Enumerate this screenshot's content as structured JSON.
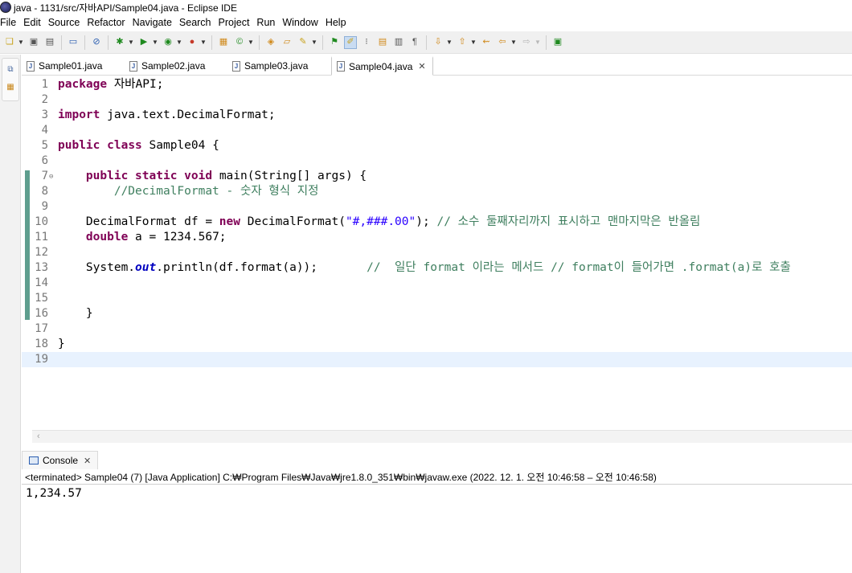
{
  "window": {
    "title": "java - 1131/src/자바API/Sample04.java - Eclipse IDE"
  },
  "menu": [
    "File",
    "Edit",
    "Source",
    "Refactor",
    "Navigate",
    "Search",
    "Project",
    "Run",
    "Window",
    "Help"
  ],
  "toolbar": {
    "icons": [
      "new-file-icon",
      "save-icon",
      "save-all-icon",
      "terminal-icon",
      "skip-breakpoints-icon",
      "debug-icon",
      "run-icon",
      "coverage-icon",
      "external-tools-icon",
      "new-java-project-icon",
      "new-class-icon",
      "open-type-icon",
      "open-folder-icon",
      "search-icon",
      "toggle-markers-icon",
      "toggle-mark-occurrences-icon",
      "block-selection-icon",
      "word-wrap-icon",
      "show-whitespace-icon",
      "next-annotation-icon",
      "previous-annotation-icon",
      "last-edit-location-icon",
      "back-icon",
      "forward-icon",
      "perspective-icon"
    ]
  },
  "editor": {
    "tabs": [
      {
        "label": "Sample01.java",
        "active": false
      },
      {
        "label": "Sample02.java",
        "active": false
      },
      {
        "label": "Sample03.java",
        "active": false
      },
      {
        "label": "Sample04.java",
        "active": true
      }
    ],
    "lines": [
      {
        "n": "1",
        "tokens": [
          [
            "kw",
            "package"
          ],
          [
            "",
            " 자바API;"
          ]
        ]
      },
      {
        "n": "2",
        "tokens": []
      },
      {
        "n": "3",
        "tokens": [
          [
            "kw",
            "import"
          ],
          [
            "",
            " java.text.DecimalFormat;"
          ]
        ]
      },
      {
        "n": "4",
        "tokens": []
      },
      {
        "n": "5",
        "tokens": [
          [
            "kw",
            "public"
          ],
          [
            "",
            " "
          ],
          [
            "kw",
            "class"
          ],
          [
            "",
            " Sample04 {"
          ]
        ]
      },
      {
        "n": "6",
        "tokens": []
      },
      {
        "n": "7",
        "fold": true,
        "tokens": [
          [
            "",
            "    "
          ],
          [
            "kw",
            "public"
          ],
          [
            "",
            " "
          ],
          [
            "kw",
            "static"
          ],
          [
            "",
            " "
          ],
          [
            "kw",
            "void"
          ],
          [
            "",
            " main(String[] args) {"
          ]
        ]
      },
      {
        "n": "8",
        "tokens": [
          [
            "",
            "        "
          ],
          [
            "cm",
            "//DecimalFormat - 숫자 형식 지정"
          ]
        ]
      },
      {
        "n": "9",
        "tokens": []
      },
      {
        "n": "10",
        "tokens": [
          [
            "",
            "    DecimalFormat df = "
          ],
          [
            "kw",
            "new"
          ],
          [
            "",
            " DecimalFormat("
          ],
          [
            "str",
            "\"#,###.00\""
          ],
          [
            "",
            "); "
          ],
          [
            "cm",
            "// 소수 둘째자리까지 표시하고 맨마지막은 반올림"
          ]
        ]
      },
      {
        "n": "11",
        "tokens": [
          [
            "",
            "    "
          ],
          [
            "kw",
            "double"
          ],
          [
            "",
            " a = 1234.567;"
          ]
        ]
      },
      {
        "n": "12",
        "tokens": []
      },
      {
        "n": "13",
        "tokens": [
          [
            "",
            "    System."
          ],
          [
            "st",
            "out"
          ],
          [
            "",
            ".println(df.format(a));       "
          ],
          [
            "cm",
            "//  일단 format 이라는 메서드 // format이 들어가면 .format(a)로 호출"
          ]
        ]
      },
      {
        "n": "14",
        "tokens": []
      },
      {
        "n": "15",
        "tokens": []
      },
      {
        "n": "16",
        "tokens": [
          [
            "",
            "    }"
          ]
        ]
      },
      {
        "n": "17",
        "tokens": []
      },
      {
        "n": "18",
        "tokens": [
          [
            "",
            "}"
          ]
        ]
      },
      {
        "n": "19",
        "current": true,
        "tokens": []
      }
    ]
  },
  "console": {
    "tab_label": "Console",
    "status": "<terminated> Sample04 (7) [Java Application] C:₩Program Files₩Java₩jre1.8.0_351₩bin₩javaw.exe  (2022. 12. 1. 오전 10:46:58 – 오전 10:46:58)",
    "output": "1,234.57"
  }
}
